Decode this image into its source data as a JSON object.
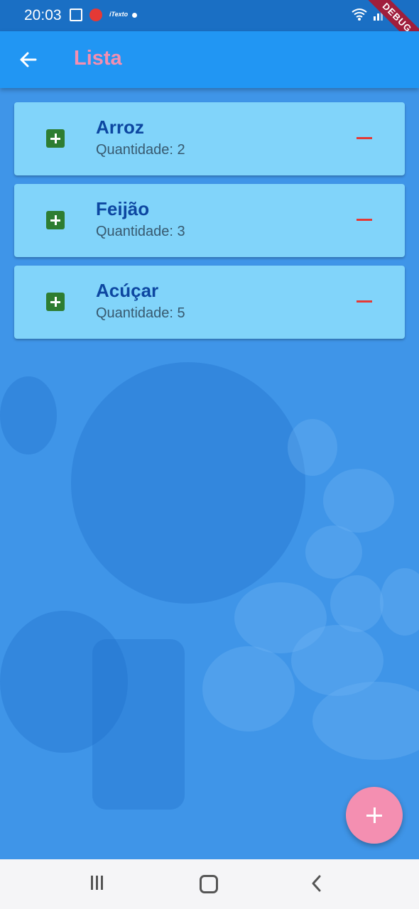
{
  "status_bar": {
    "time": "20:03",
    "notification_icons": [
      "gallery-icon",
      "youtube-icon",
      "app-tag-icon",
      "dot-icon"
    ],
    "app_tag_text": "iTexto",
    "system_icons": [
      "wifi-icon",
      "signal-icon"
    ]
  },
  "debug_banner": "DEBUG",
  "app_bar": {
    "title": "Lista",
    "back_icon": "arrow-back-icon",
    "title_color": "#f48fb1",
    "background": "#2196f3"
  },
  "items": [
    {
      "name": "Arroz",
      "quantity_label": "Quantidade: 2"
    },
    {
      "name": "Feijão",
      "quantity_label": "Quantidade: 3"
    },
    {
      "name": "Acúçar",
      "quantity_label": "Quantidade: 5"
    }
  ],
  "colors": {
    "card": "#81d4fa",
    "add": "#2e7d32",
    "remove": "#e53935",
    "fab": "#f48fb1"
  },
  "fab_icon": "add-icon",
  "nav_bar": [
    "recents-icon",
    "home-icon",
    "back-icon"
  ]
}
